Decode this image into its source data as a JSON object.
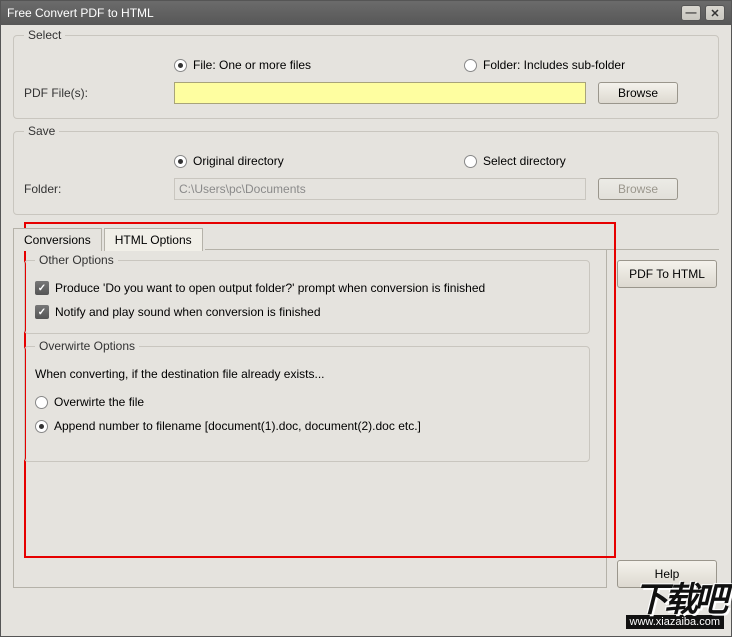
{
  "title": "Free Convert PDF to HTML",
  "select": {
    "legend": "Select",
    "file_radio": "File:  One or more files",
    "folder_radio": "Folder: Includes sub-folder",
    "pdf_label": "PDF File(s):",
    "pdf_value": "",
    "browse": "Browse"
  },
  "save": {
    "legend": "Save",
    "original": "Original directory",
    "select_dir": "Select directory",
    "folder_label": "Folder:",
    "folder_value": "C:\\Users\\pc\\Documents",
    "browse": "Browse"
  },
  "tabs": {
    "conversions": "Conversions",
    "html_options": "HTML Options"
  },
  "other": {
    "legend": "Other Options",
    "produce": "Produce 'Do you want to open output folder?' prompt when conversion is finished",
    "notify": "Notify and play sound when conversion is finished"
  },
  "overwrite": {
    "legend": "Overwirte Options",
    "when": "When converting, if the destination file already exists...",
    "overwrite_file": "Overwirte the file",
    "append": "Append number to filename  [document(1).doc, document(2).doc etc.]"
  },
  "actions": {
    "convert": "PDF To HTML",
    "help": "Help"
  },
  "watermark": {
    "text": "下载吧",
    "url": "www.xiazaiba.com"
  }
}
